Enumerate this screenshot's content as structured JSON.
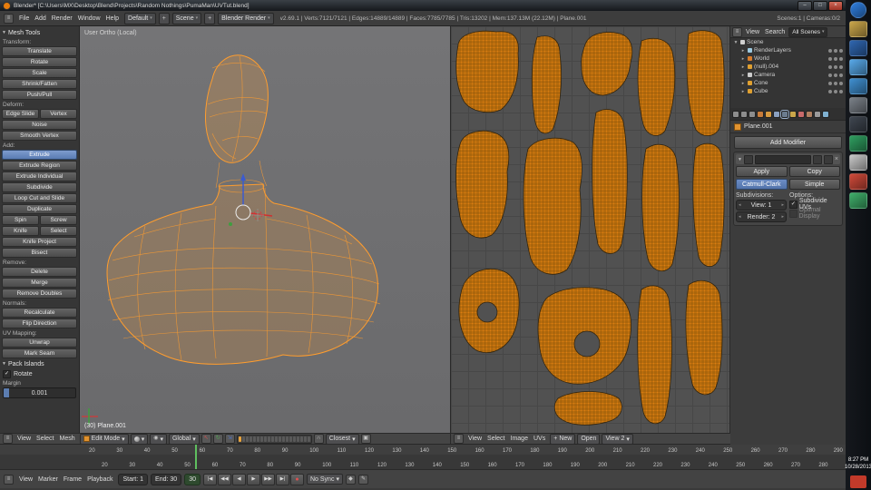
{
  "icons": {
    "collapse": "▼",
    "dropdown": "▾",
    "check": "✓",
    "expand": "▸",
    "plus": "+",
    "close": "×",
    "minimize": "–",
    "maximize": "□",
    "menu": "≡",
    "magnet": "∩",
    "record": "●"
  },
  "window": {
    "title": "Blender* [C:\\Users\\MX\\Desktop\\Blend\\Projects\\Random Nothings\\PumaMan\\UVTut.blend]"
  },
  "topbar": {
    "menus": [
      "File",
      "Add",
      "Render",
      "Window",
      "Help"
    ],
    "layout_name": "Default",
    "scene_name": "Scene",
    "engine": "Blender Render",
    "stats": "v2.69.1 | Verts:7121/7121 | Edges:14889/14889 | Faces:7785/7785 | Tris:13202 | Mem:137.13M (22.12M) | Plane.001",
    "right_info": "Scenes:1 | Cameras:0/2"
  },
  "toolshelf": {
    "panel_title": "Mesh Tools",
    "active_button": "Extrude",
    "sections": [
      {
        "label": "Transform:",
        "rows": [
          [
            "Translate"
          ],
          [
            "Rotate"
          ],
          [
            "Scale"
          ],
          [
            "Shrink/Fatten"
          ],
          [
            "Push/Pull"
          ]
        ]
      },
      {
        "label": "Deform:",
        "rows": [
          [
            "Edge Slide",
            "Vertex"
          ],
          [
            "Noise"
          ],
          [
            "Smooth Vertex"
          ]
        ]
      },
      {
        "label": "Add:",
        "rows": [
          [
            "Extrude"
          ],
          [
            "Extrude Region"
          ],
          [
            "Extrude Individual"
          ],
          [
            "Subdivide"
          ],
          [
            "Loop Cut and Slide"
          ],
          [
            "Duplicate"
          ],
          [
            "Spin",
            "Screw"
          ],
          [
            "Knife",
            "Select"
          ],
          [
            "Knife Project"
          ],
          [
            "Bisect"
          ]
        ]
      },
      {
        "label": "Remove:",
        "rows": [
          [
            "Delete"
          ],
          [
            "Merge"
          ],
          [
            "Remove Doubles"
          ]
        ]
      },
      {
        "label": "Normals:",
        "rows": [
          [
            "Recalculate"
          ],
          [
            "Flip Direction"
          ]
        ]
      },
      {
        "label": "UV Mapping:",
        "rows": [
          [
            "Unwrap"
          ],
          [
            "Mark Seam"
          ]
        ]
      }
    ],
    "pack_islands": {
      "panel_title": "Pack Islands",
      "rotate_label": "Rotate",
      "margin_label": "Margin",
      "margin_value": "0.001"
    }
  },
  "viewport3d": {
    "view_label": "User Ortho (Local)",
    "object_label": "(30) Plane.001",
    "header": {
      "menus": [
        "View",
        "Select",
        "Mesh"
      ],
      "mode": "Edit Mode",
      "orientation": "Global",
      "snap": "Closest"
    }
  },
  "uv_editor": {
    "header": {
      "menus": [
        "View",
        "Select",
        "Image",
        "UVs"
      ],
      "new_label": "New",
      "open_label": "Open",
      "view_label": "View 2"
    }
  },
  "outliner": {
    "header": {
      "menus": [
        "View",
        "Search"
      ],
      "display": "All Scenes"
    },
    "items": [
      {
        "label": "Scene",
        "indent": 0,
        "color": "#cfcfcf"
      },
      {
        "label": "RenderLayers",
        "indent": 1,
        "color": "#9ecae1"
      },
      {
        "label": "World",
        "indent": 1,
        "color": "#d97c2b"
      },
      {
        "label": "(null).004",
        "indent": 1,
        "color": "#e0a030"
      },
      {
        "label": "Camera",
        "indent": 1,
        "color": "#cccccc"
      },
      {
        "label": "Cone",
        "indent": 1,
        "color": "#e0a030"
      },
      {
        "label": "Cube",
        "indent": 1,
        "color": "#e0a030"
      }
    ]
  },
  "properties": {
    "tabs": [
      {
        "name": "render",
        "color": "#8d8d8d"
      },
      {
        "name": "render-layers",
        "color": "#8d8d8d"
      },
      {
        "name": "scene",
        "color": "#8d8d8d"
      },
      {
        "name": "world",
        "color": "#c87c3a"
      },
      {
        "name": "object",
        "color": "#d89a3f"
      },
      {
        "name": "constraints",
        "color": "#8aa0c0"
      },
      {
        "name": "modifiers",
        "color": "#9aa8b8",
        "active": true
      },
      {
        "name": "data",
        "color": "#caa64a"
      },
      {
        "name": "material",
        "color": "#c86a6a"
      },
      {
        "name": "texture",
        "color": "#b08060"
      },
      {
        "name": "particles",
        "color": "#9a9a9a"
      },
      {
        "name": "physics",
        "color": "#7fb0d0"
      }
    ],
    "breadcrumb": "Plane.001",
    "add_modifier_label": "Add Modifier",
    "modifier": {
      "apply_label": "Apply",
      "copy_label": "Copy",
      "type_catmull": "Catmull-Clark",
      "type_simple": "Simple",
      "subdivisions_label": "Subdivisions:",
      "options_label": "Options:",
      "view_label": "View: 1",
      "render_label": "Render: 2",
      "subdivide_uvs_label": "Subdivide UVs",
      "optimal_label": "Optimal Display"
    }
  },
  "timeline": {
    "header": {
      "menus": [
        "View",
        "Marker",
        "Frame",
        "Playback"
      ],
      "start": "Start: 1",
      "end": "End: 30",
      "frame": "30",
      "sync": "No Sync",
      "transport": [
        {
          "name": "jump-to-start",
          "glyph": "|◀"
        },
        {
          "name": "prev-keyframe",
          "glyph": "◀◀"
        },
        {
          "name": "play-reverse",
          "glyph": "◀"
        },
        {
          "name": "play",
          "glyph": "▶"
        },
        {
          "name": "next-keyframe",
          "glyph": "▶▶"
        },
        {
          "name": "jump-to-end",
          "glyph": "▶|"
        },
        {
          "name": "record",
          "glyph": "●"
        }
      ]
    },
    "ticks": [
      "20",
      "30",
      "40",
      "50",
      "60",
      "70",
      "80",
      "90",
      "100",
      "110",
      "120",
      "130",
      "140",
      "150",
      "160",
      "170",
      "180",
      "190",
      "200",
      "210",
      "220",
      "230",
      "240",
      "250",
      "260",
      "270",
      "280",
      "290"
    ]
  },
  "taskbar": {
    "clock_time": "8:27 PM",
    "clock_date": "10/28/2013",
    "icons": [
      {
        "name": "start-orb",
        "color": "#2f7fe0"
      },
      {
        "name": "app-explorer",
        "color": "#caa64a"
      },
      {
        "name": "app-media",
        "color": "#2f66b0"
      },
      {
        "name": "app-browser",
        "color": "#57a8e8"
      },
      {
        "name": "app-chat",
        "color": "#3f8fd0"
      },
      {
        "name": "app-tool",
        "color": "#7a8088"
      },
      {
        "name": "app-editor",
        "color": "#3f4650"
      },
      {
        "name": "app-green",
        "color": "#2f9e60"
      },
      {
        "name": "app-gray",
        "color": "#c8c8c8"
      },
      {
        "name": "app-red",
        "color": "#d04a3a"
      },
      {
        "name": "app-capture",
        "color": "#3fae6a"
      }
    ]
  }
}
